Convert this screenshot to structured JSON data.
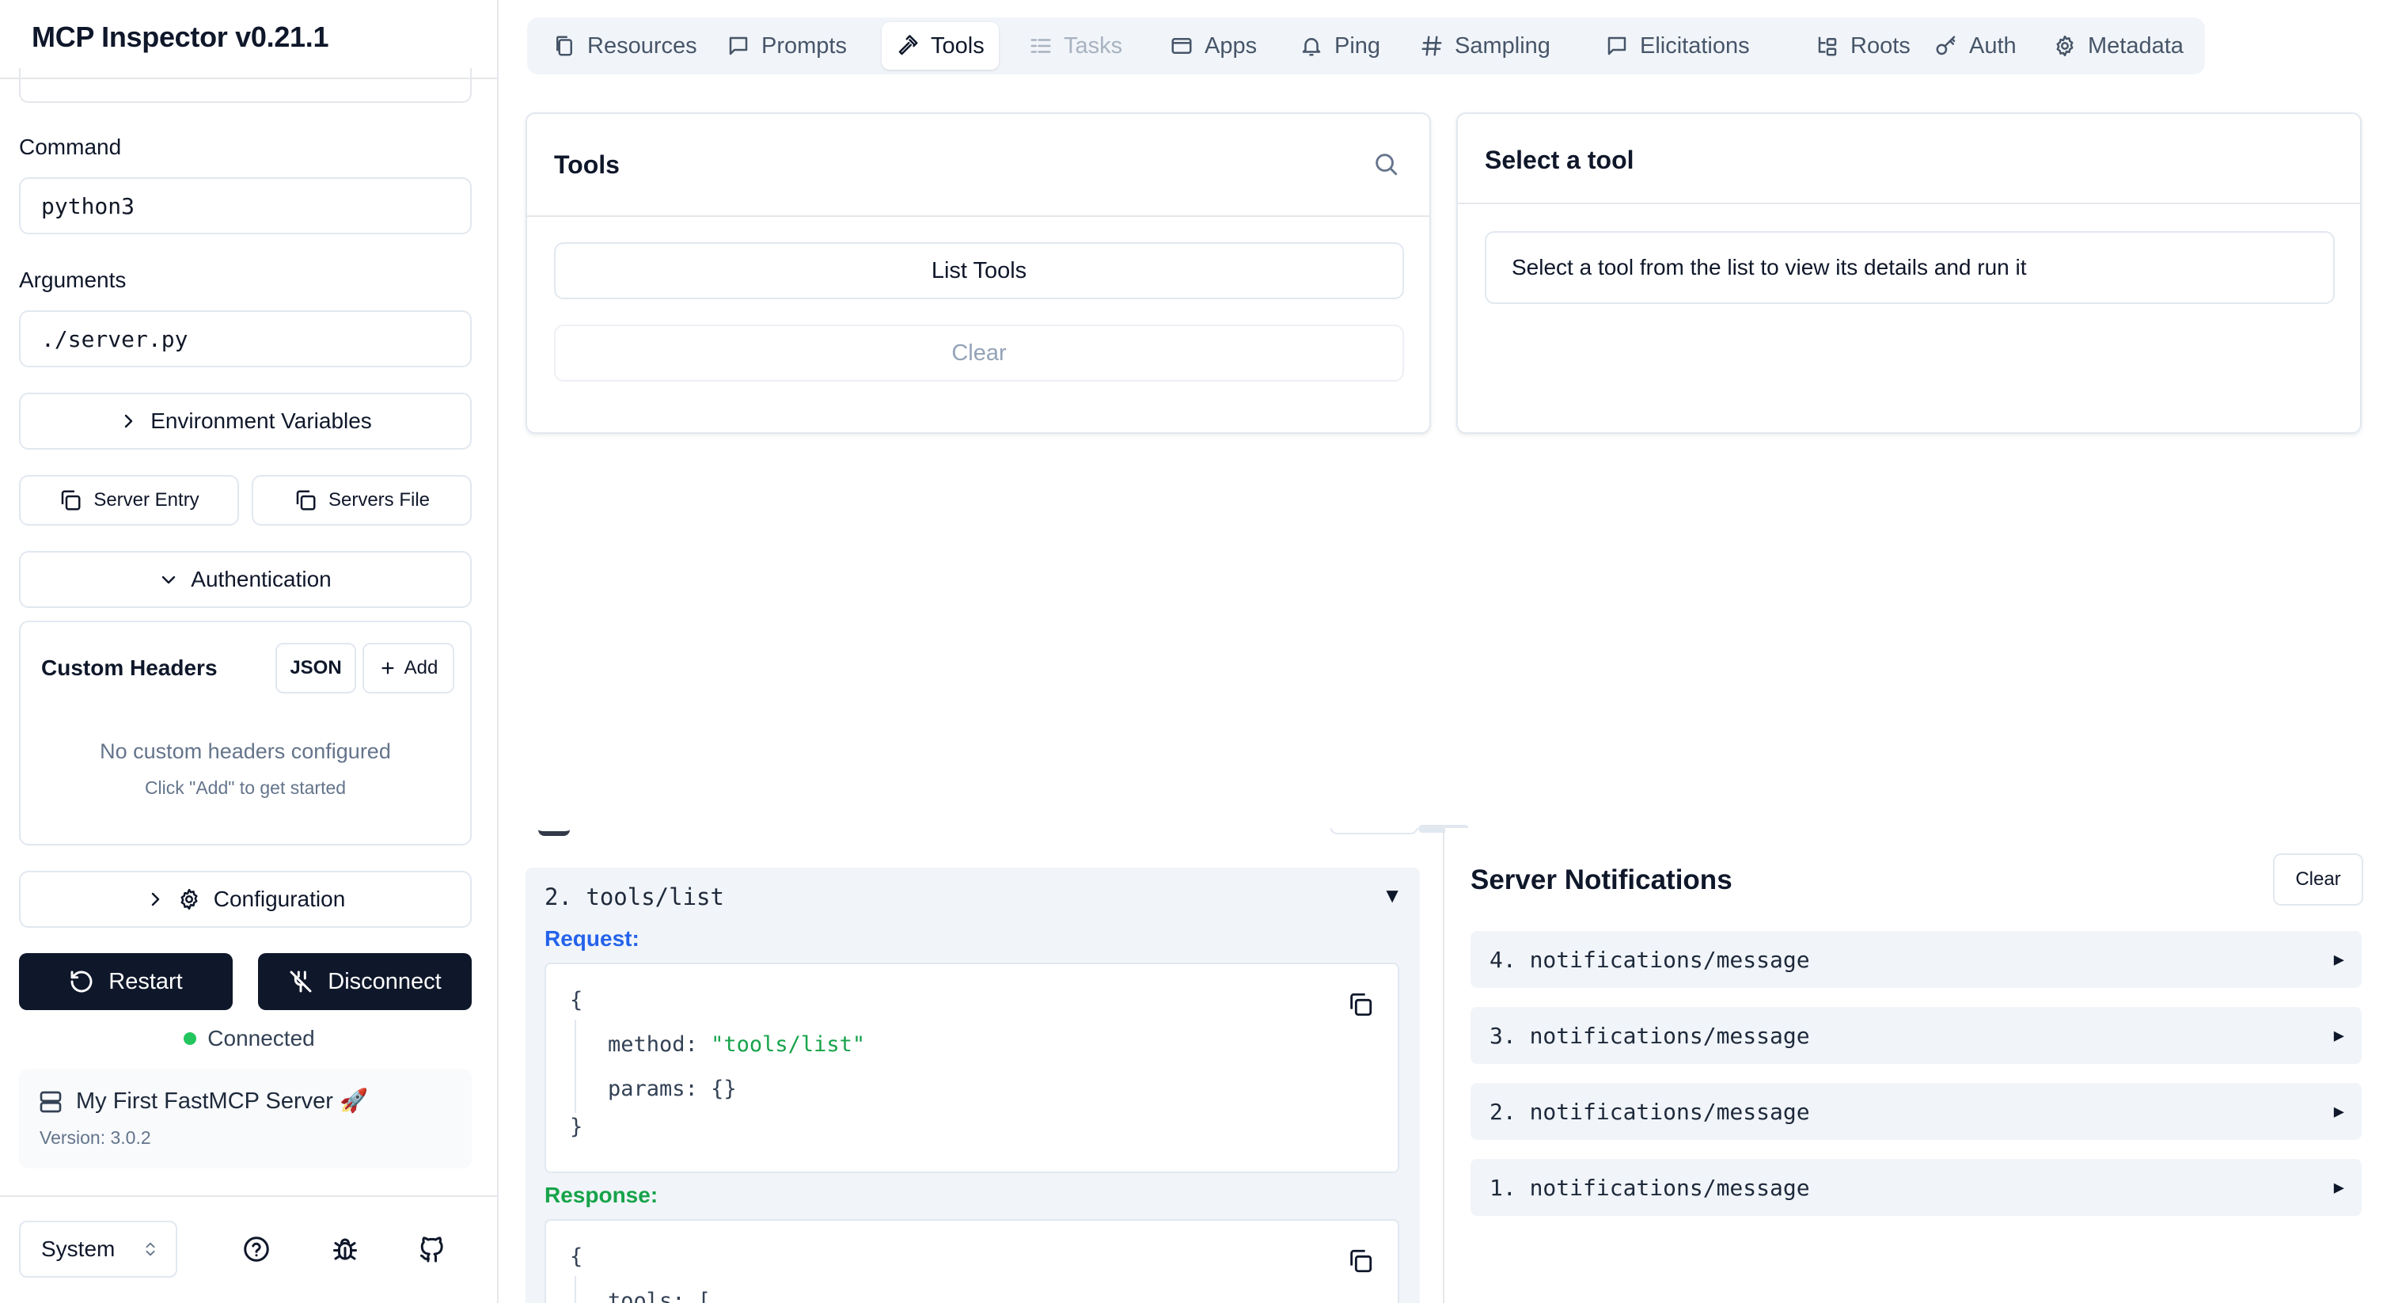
{
  "app": {
    "title": "MCP Inspector v0.21.1"
  },
  "sidebar": {
    "command": {
      "label": "Command",
      "value": "python3"
    },
    "arguments": {
      "label": "Arguments",
      "value": "./server.py"
    },
    "env_vars_label": "Environment Variables",
    "server_entry_label": "Server Entry",
    "servers_file_label": "Servers File",
    "authentication_label": "Authentication",
    "custom_headers": {
      "title": "Custom Headers",
      "json_label": "JSON",
      "add_label": "Add",
      "empty_title": "No custom headers configured",
      "empty_hint": "Click \"Add\" to get started"
    },
    "configuration_label": "Configuration",
    "restart_label": "Restart",
    "disconnect_label": "Disconnect",
    "status": {
      "label": "Connected",
      "color": "#22c55e"
    },
    "server": {
      "name": "My First FastMCP Server 🚀",
      "version": "Version: 3.0.2"
    },
    "theme": {
      "value": "System"
    }
  },
  "tabs": [
    {
      "label": "Resources",
      "icon": "files-icon"
    },
    {
      "label": "Prompts",
      "icon": "message-square-icon"
    },
    {
      "label": "Tools",
      "icon": "hammer-icon",
      "active": true
    },
    {
      "label": "Tasks",
      "icon": "list-todo-icon",
      "disabled": true
    },
    {
      "label": "Apps",
      "icon": "app-window-icon"
    },
    {
      "label": "Ping",
      "icon": "bell-icon"
    },
    {
      "label": "Sampling",
      "icon": "hash-icon"
    },
    {
      "label": "Elicitations",
      "icon": "message-square-icon"
    },
    {
      "label": "Roots",
      "icon": "folder-tree-icon"
    },
    {
      "label": "Auth",
      "icon": "key-icon"
    },
    {
      "label": "Metadata",
      "icon": "gear-icon"
    }
  ],
  "tools_panel": {
    "title": "Tools",
    "list_tools_label": "List Tools",
    "clear_label": "Clear"
  },
  "detail_panel": {
    "title": "Select a tool",
    "message": "Select a tool from the list to view its details and run it"
  },
  "history": {
    "entry": {
      "title": "2. tools/list",
      "request_label": "Request:",
      "response_label": "Response:",
      "request_method_key": "method:",
      "request_method_value": "\"tools/list\"",
      "request_params_key": "params:",
      "request_params_value": "{}",
      "response_tools_key": "tools: ["
    }
  },
  "notifications": {
    "title": "Server Notifications",
    "clear_label": "Clear",
    "items": [
      "4. notifications/message",
      "3. notifications/message",
      "2. notifications/message",
      "1. notifications/message"
    ]
  }
}
